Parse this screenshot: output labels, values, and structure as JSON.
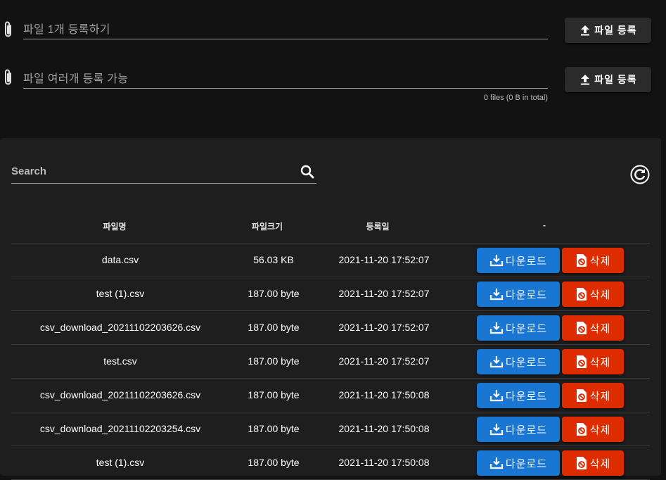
{
  "upload": [
    {
      "placeholder": "파일 1개 등록하기",
      "button_label": "파일 등록"
    },
    {
      "placeholder": "파일 여러개 등록 가능",
      "button_label": "파일 등록"
    }
  ],
  "upload_hint": "0 files (0 B in total)",
  "search": {
    "placeholder": "Search"
  },
  "table": {
    "headers": [
      "파일명",
      "파일크기",
      "등록일",
      "-"
    ],
    "download_label": "다운로드",
    "delete_label": "삭제",
    "rows": [
      {
        "name": "data.csv",
        "size": "56.03 KB",
        "date": "2021-11-20 17:52:07"
      },
      {
        "name": "test (1).csv",
        "size": "187.00 byte",
        "date": "2021-11-20 17:52:07"
      },
      {
        "name": "csv_download_20211102203626.csv",
        "size": "187.00 byte",
        "date": "2021-11-20 17:52:07"
      },
      {
        "name": "test.csv",
        "size": "187.00 byte",
        "date": "2021-11-20 17:52:07"
      },
      {
        "name": "csv_download_20211102203626.csv",
        "size": "187.00 byte",
        "date": "2021-11-20 17:50:08"
      },
      {
        "name": "csv_download_20211102203254.csv",
        "size": "187.00 byte",
        "date": "2021-11-20 17:50:08"
      },
      {
        "name": "test (1).csv",
        "size": "187.00 byte",
        "date": "2021-11-20 17:50:08"
      }
    ]
  },
  "colors": {
    "download": "#1976d2",
    "delete": "#dd2c00",
    "background": "#121212",
    "card": "#1e1e1e"
  },
  "icons": [
    "paperclip-icon",
    "upload-icon",
    "search-icon",
    "refresh-icon",
    "download-icon",
    "delete-file-icon"
  ]
}
